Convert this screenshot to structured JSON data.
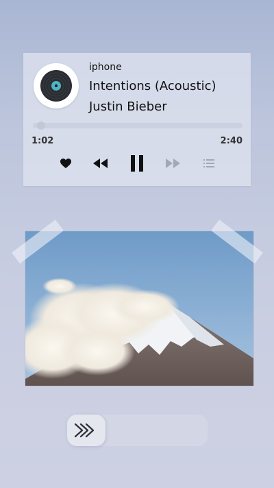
{
  "player": {
    "source": "iphone",
    "title": "Intentions (Acoustic)",
    "artist": "Justin Bieber",
    "time_current": "1:02",
    "time_total": "2:40",
    "progress_fraction": 0.02,
    "controls": [
      "heart-icon",
      "rewind-icon",
      "pause-icon",
      "fast-forward-icon",
      "list-icon"
    ]
  },
  "photo": {
    "subject": "snow-capped-mountain-with-clouds",
    "colors": {
      "sky": "#7fa6cf",
      "snow": "#f2f4f6",
      "rock": "#7c6a64"
    }
  },
  "slider": {
    "icon": "double-chevron-right-icon"
  },
  "colors": {
    "background_top": "#a9b6d3",
    "background_bottom": "#cdd0e3",
    "text": "#111111"
  }
}
